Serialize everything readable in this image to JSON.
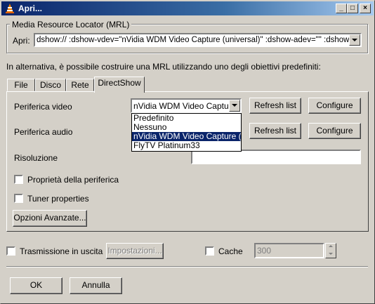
{
  "window": {
    "title": "Apri..."
  },
  "mrl": {
    "group_label": "Media Resource Locator (MRL)",
    "open_label": "Apri:",
    "value": "dshow:// :dshow-vdev=\"nVidia WDM Video Capture (universal)\" :dshow-adev=\"\" :dshow-size"
  },
  "hint": "In alternativa, è possibile costruire una MRL utilizzando uno degli obiettivi predefiniti:",
  "tabs": [
    {
      "label": "File"
    },
    {
      "label": "Disco"
    },
    {
      "label": "Rete"
    },
    {
      "label": "DirectShow"
    }
  ],
  "directshow": {
    "video_label": "Periferica video",
    "video_value": "nVidia WDM Video Capture",
    "video_options": [
      "Predefinito",
      "Nessuno",
      "nVidia WDM Video Capture (univ",
      "FlyTV Platinum33"
    ],
    "video_selected_index": 2,
    "audio_label": "Periferica audio",
    "refresh_label": "Refresh list",
    "configure_label": "Configure",
    "resolution_label": "Risoluzione",
    "resolution_value": "",
    "device_props_label": "Proprietà della periferica",
    "tuner_props_label": "Tuner properties",
    "advanced_label": "Opzioni Avanzate..."
  },
  "output": {
    "stream_label": "Trasmissione in uscita",
    "settings_label": "Impostazioni...",
    "cache_label": "Cache",
    "cache_value": "300"
  },
  "footer": {
    "ok_label": "OK",
    "cancel_label": "Annulla"
  }
}
